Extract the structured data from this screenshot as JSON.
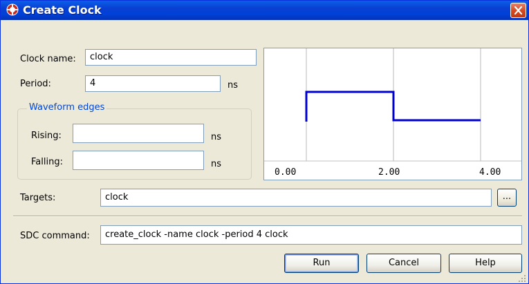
{
  "window": {
    "title": "Create Clock",
    "title_icon": "clock-app-icon",
    "close_icon": "close-icon",
    "colors": {
      "titlebar": "#0a3fd2",
      "close": "#d5481f",
      "group_title": "#0046d5",
      "waveform": "#0000cc",
      "background": "#ece9d8"
    }
  },
  "form": {
    "clock_name_label": "Clock name:",
    "clock_name_value": "clock",
    "period_label": "Period:",
    "period_value": "4",
    "period_unit": "ns",
    "waveform_group_title": "Waveform edges",
    "rising_label": "Rising:",
    "rising_value": "",
    "rising_unit": "ns",
    "falling_label": "Falling:",
    "falling_value": "",
    "falling_unit": "ns",
    "targets_label": "Targets:",
    "targets_value": "clock",
    "browse_button_label": "...",
    "sdc_label": "SDC command:",
    "sdc_value": "create_clock -name clock -period 4 clock"
  },
  "waveform_preview": {
    "tick_labels": [
      "0.00",
      "2.00",
      "4.00"
    ],
    "period_ns": 4,
    "rising_ns": 0,
    "falling_ns": 2
  },
  "buttons": {
    "run": "Run",
    "cancel": "Cancel",
    "help": "Help"
  }
}
